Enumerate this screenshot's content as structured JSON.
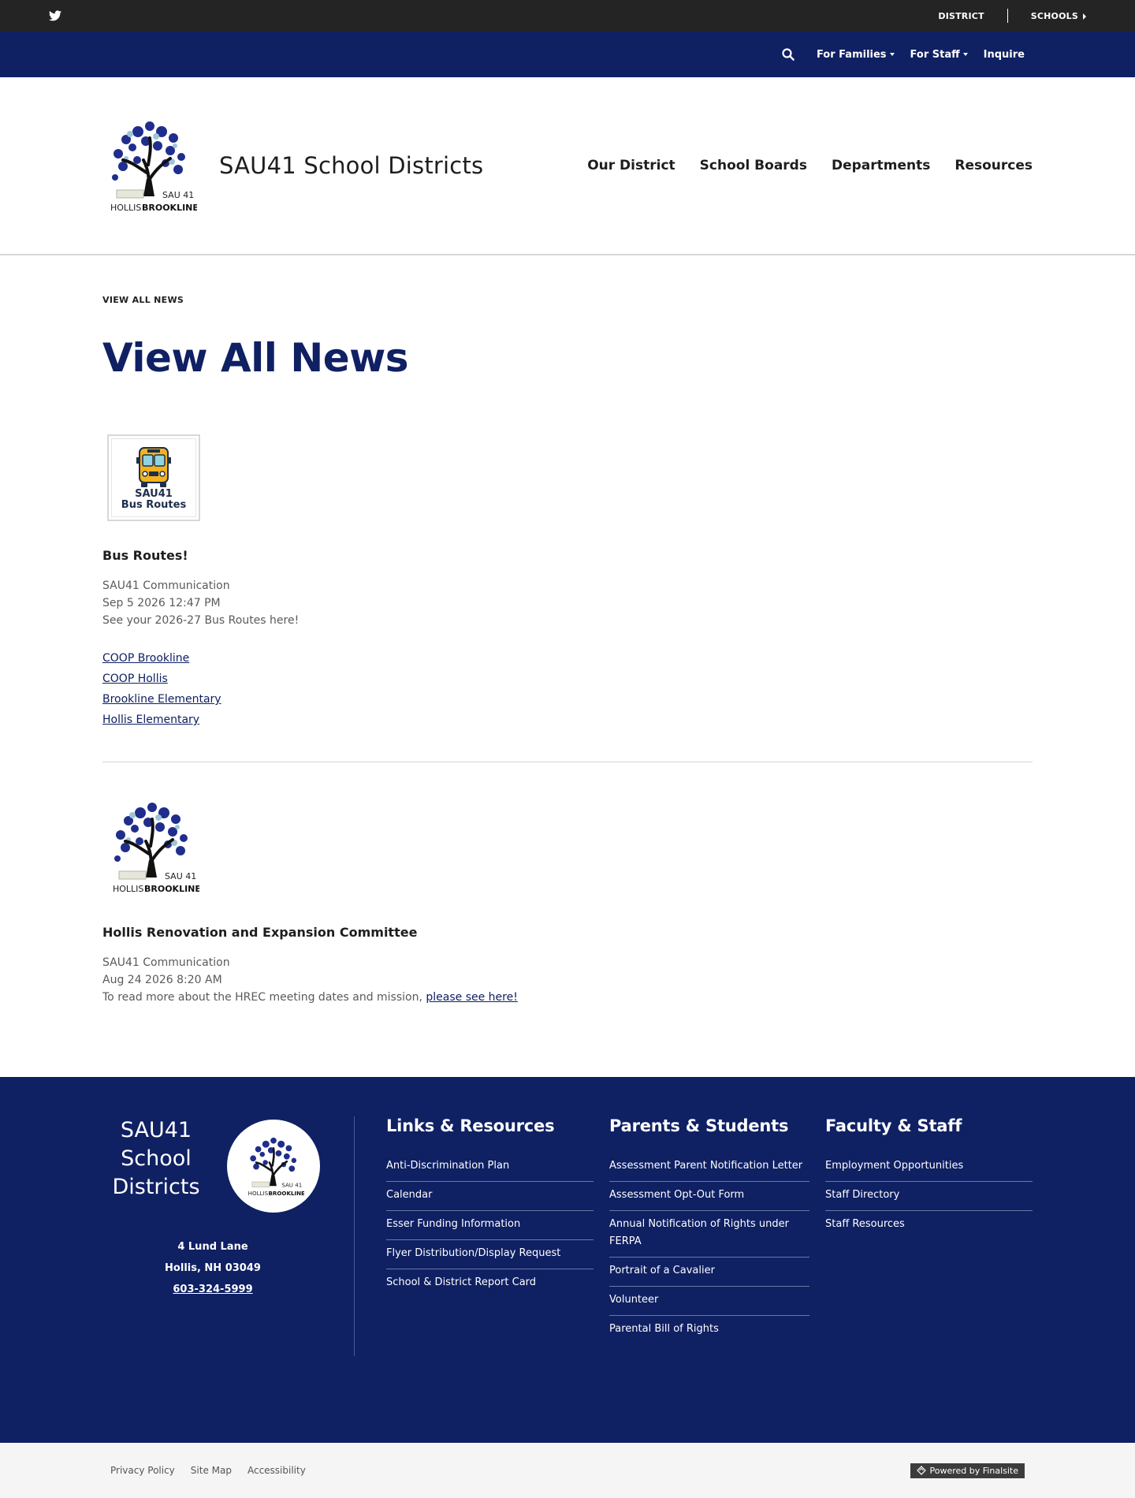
{
  "utility_bar": {
    "twitter_icon": "twitter-icon",
    "district_label": "DISTRICT",
    "schools_label": "SCHOOLS"
  },
  "blue_nav": {
    "search_icon": "search-icon",
    "items": [
      {
        "label": "For Families",
        "has_dropdown": true
      },
      {
        "label": "For Staff",
        "has_dropdown": true
      },
      {
        "label": "Inquire",
        "has_dropdown": false
      }
    ]
  },
  "header": {
    "site_title": "SAU41 School Districts",
    "logo_text_top": "SAU 41",
    "logo_text_left": "HOLLIS",
    "logo_text_right": "BROOKLINE",
    "main_nav": [
      "Our District",
      "School Boards",
      "Departments",
      "Resources"
    ]
  },
  "content": {
    "breadcrumb": "VIEW ALL NEWS",
    "page_title": "View All News",
    "news": [
      {
        "thumb_line1": "SAU41",
        "thumb_line2": "Bus Routes",
        "title": "Bus Routes!",
        "author": "SAU41 Communication",
        "date": "Sep 5 2026 12:47 PM",
        "summary": "See your 2026-27 Bus Routes here!",
        "links": [
          "COOP Brookline",
          "COOP Hollis",
          "Brookline Elementary",
          "Hollis Elementary"
        ]
      },
      {
        "title": "Hollis Renovation and Expansion Committee",
        "author": "SAU41 Communication",
        "date": "Aug 24 2026 8:20 AM",
        "summary": "To read more about the HREC meeting dates and mission, ",
        "link_text": "please see here!"
      }
    ]
  },
  "footer": {
    "name_line1": "SAU41",
    "name_line2": "School",
    "name_line3": "Districts",
    "address_line1": "4 Lund Lane",
    "address_line2": "Hollis, NH  03049",
    "phone": "603-324-5999",
    "columns": [
      {
        "heading": "Links & Resources",
        "items": [
          "Anti-Discrimination Plan",
          "Calendar",
          "Esser Funding Information",
          "Flyer Distribution/Display Request",
          "School & District Report Card"
        ]
      },
      {
        "heading": "Parents & Students",
        "items": [
          "Assessment Parent Notification Letter",
          "Assessment Opt-Out Form",
          "Annual Notification of Rights under FERPA",
          "Portrait of a Cavalier",
          "Volunteer",
          "Parental Bill of Rights"
        ]
      },
      {
        "heading": "Faculty & Staff",
        "items": [
          "Employment Opportunities",
          "Staff Directory",
          "Staff Resources"
        ]
      }
    ]
  },
  "bottom_bar": {
    "links": [
      "Privacy Policy",
      "Site Map",
      "Accessibility"
    ],
    "powered_by": "Powered by Finalsite"
  },
  "colors": {
    "navy": "#0f2063",
    "utility_dark": "#242424",
    "bottom_bar_bg": "#f5f5f5"
  }
}
